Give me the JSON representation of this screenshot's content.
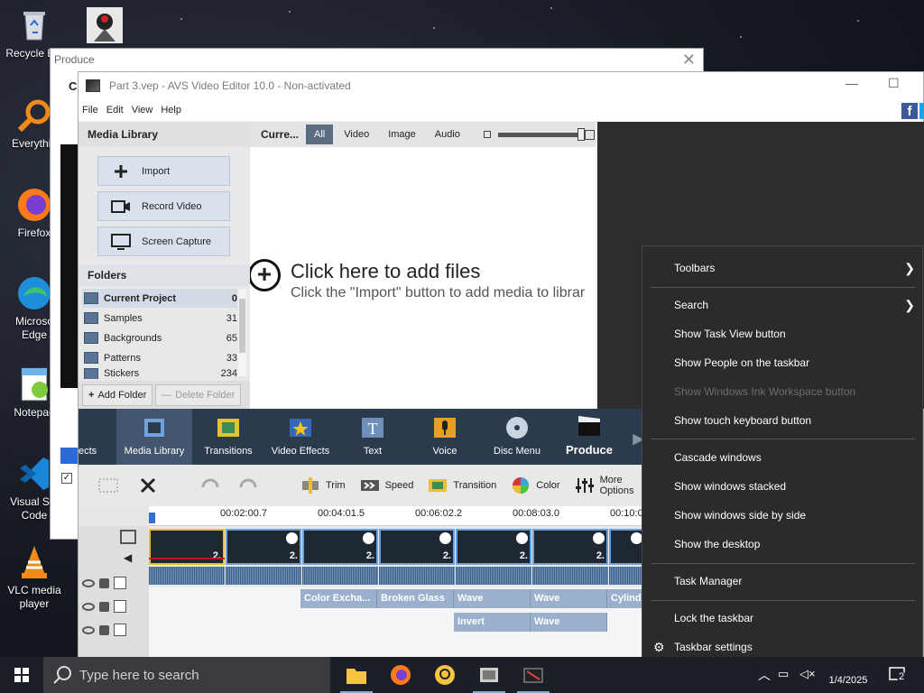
{
  "desktop": {
    "icons": [
      {
        "label": "Recycle Bin",
        "icon": "recycle-bin-icon"
      },
      {
        "label": "",
        "icon": "java-icon"
      },
      {
        "label": "Everythin",
        "icon": "everything-search-icon"
      },
      {
        "label": "Firefox",
        "icon": "firefox-icon"
      },
      {
        "label": "Microsoft Edge",
        "label1": "Microso",
        "label2": "Edge",
        "icon": "edge-icon"
      },
      {
        "label": "Notepad",
        "icon": "notepad-icon"
      },
      {
        "label1": "Visual Stu",
        "label2": "Code",
        "icon": "vscode-icon"
      },
      {
        "label1": "VLC media",
        "label2": "player",
        "icon": "vlc-icon"
      }
    ]
  },
  "produce_window": {
    "title": "Produce",
    "side_text": "Cr"
  },
  "avs": {
    "title": "Part 3.vep - AVS Video Editor 10.0 - Non-activated",
    "menu": [
      "File",
      "Edit",
      "View",
      "Help"
    ],
    "media_library": {
      "heading": "Media Library",
      "buttons": [
        "Import",
        "Record Video",
        "Screen Capture"
      ],
      "folders_heading": "Folders",
      "folders": [
        {
          "name": "Current Project",
          "count": "0"
        },
        {
          "name": "Samples",
          "count": "31"
        },
        {
          "name": "Backgrounds",
          "count": "65"
        },
        {
          "name": "Patterns",
          "count": "33"
        },
        {
          "name": "Stickers",
          "count": "234"
        }
      ],
      "add_folder": "Add Folder",
      "delete_folder": "Delete Folder"
    },
    "content": {
      "label": "Curre...",
      "tabs": [
        "All",
        "Video",
        "Image",
        "Audio"
      ],
      "active_tab": "All",
      "zoom_level": 1.0,
      "drop_title": "Click here to add files",
      "drop_subtitle": "Click the \"Import\" button to add media to librar"
    },
    "ribbon": [
      "ects",
      "Media Library",
      "Transitions",
      "Video Effects",
      "Text",
      "Voice",
      "Disc Menu",
      "Produce"
    ],
    "toolbar": [
      "Trim",
      "Speed",
      "Transition",
      "Color",
      "More Options"
    ],
    "ruler_ticks": [
      "00:02:00.7",
      "00:04:01.5",
      "00:06:02.2",
      "00:08:03.0",
      "00:10:0"
    ],
    "clips_dur": "2.",
    "effects_row1": [
      "Color Excha...",
      "Broken Glass",
      "Wave",
      "Wave",
      "Cylinde"
    ],
    "effects_row2": [
      "Invert",
      "Wave"
    ]
  },
  "context_menu": {
    "items": [
      {
        "label": "Toolbars",
        "submenu": true
      },
      {
        "label": "Search",
        "submenu": true
      },
      {
        "label": "Show Task View button"
      },
      {
        "label": "Show People on the taskbar"
      },
      {
        "label": "Show Windows Ink Workspace button",
        "disabled": true
      },
      {
        "label": "Show touch keyboard button"
      },
      {
        "label": "Cascade windows"
      },
      {
        "label": "Show windows stacked"
      },
      {
        "label": "Show windows side by side"
      },
      {
        "label": "Show the desktop"
      },
      {
        "label": "Task Manager"
      },
      {
        "label": "Lock the taskbar"
      },
      {
        "label": "Taskbar settings"
      }
    ]
  },
  "taskbar": {
    "search_placeholder": "Type here to search",
    "date": "1/4/2025",
    "notification_count": "2"
  },
  "colors": {
    "accent": "#2b3a4d",
    "selection": "#5c6c80",
    "menu_bg": "#2b2b2b"
  }
}
